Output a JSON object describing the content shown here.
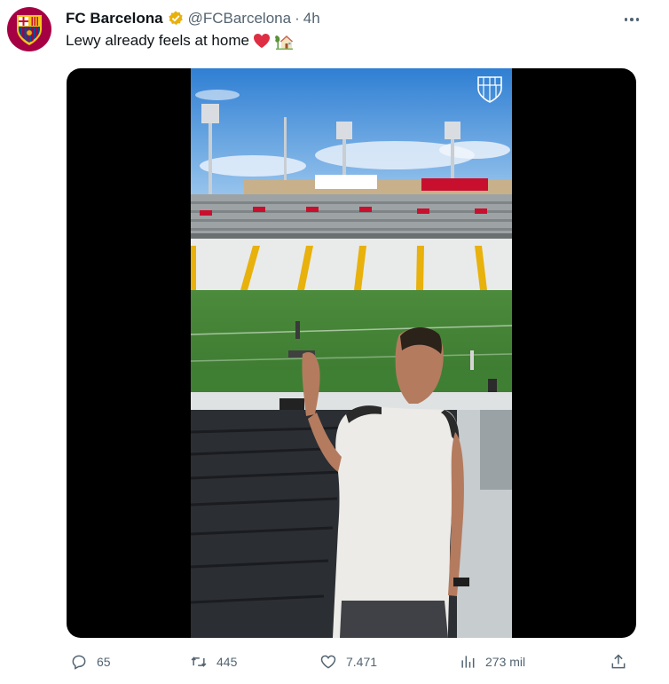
{
  "tweet": {
    "author": {
      "name": "FC Barcelona",
      "handle": "@FCBarcelona",
      "separator": "·",
      "time": "4h",
      "avatar_icon": "fc-barcelona-crest-icon",
      "verified_icon": "gold-verified-badge-icon"
    },
    "text": "Lewy already feels at home",
    "text_emojis": [
      "red-heart-icon",
      "house-with-garden-icon"
    ],
    "media": {
      "type": "video",
      "watermark_icon": "fc-barcelona-crest-icon"
    },
    "actions": {
      "replies": "65",
      "retweets": "445",
      "likes": "7.471",
      "views": "273 mil"
    }
  },
  "colors": {
    "club": "#a50044",
    "club_blue": "#004d98",
    "verified": "#e8b00c",
    "secondary_text": "#536471"
  }
}
